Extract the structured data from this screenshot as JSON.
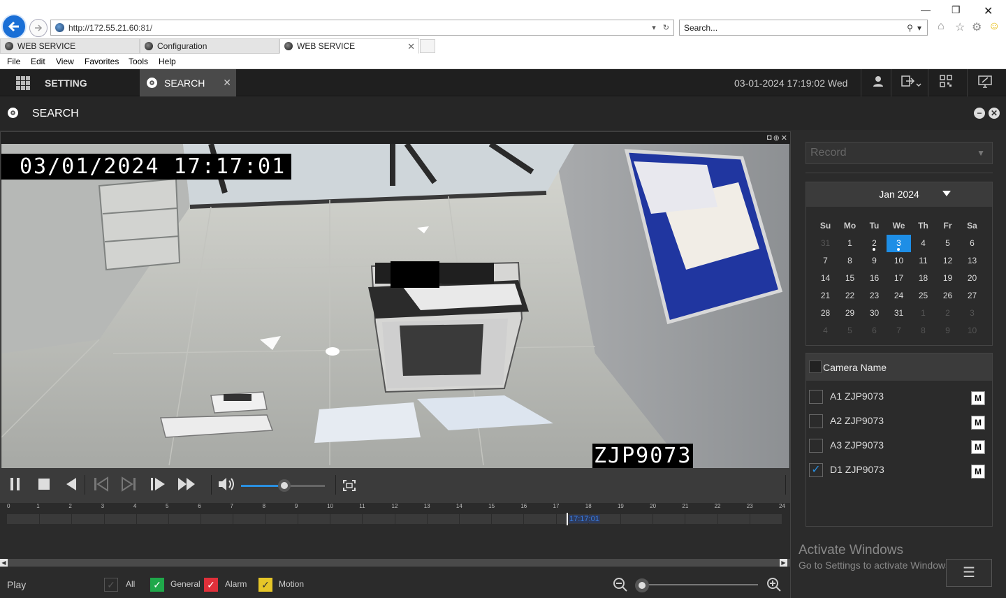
{
  "browser": {
    "url_host": "http://172.55.21.60",
    "url_port": ":81/",
    "search_placeholder": "Search...",
    "tabs": [
      {
        "label": "WEB SERVICE"
      },
      {
        "label": "Configuration"
      },
      {
        "label": "WEB SERVICE"
      }
    ],
    "menu": [
      "File",
      "Edit",
      "View",
      "Favorites",
      "Tools",
      "Help"
    ]
  },
  "header": {
    "setting_label": "SETTING",
    "search_tab_label": "SEARCH",
    "datetime": "03-01-2024 17:19:02 Wed"
  },
  "panel": {
    "title": "SEARCH"
  },
  "video": {
    "osd_time": "03/01/2024 17:17:01",
    "osd_camera": "ZJP9073",
    "volume_level": 0.52
  },
  "timeline": {
    "hours": [
      "0",
      "1",
      "2",
      "3",
      "4",
      "5",
      "6",
      "7",
      "8",
      "9",
      "10",
      "11",
      "12",
      "13",
      "14",
      "15",
      "16",
      "17",
      "18",
      "19",
      "20",
      "21",
      "22",
      "23",
      "24"
    ],
    "cursor_time": "17:17:01"
  },
  "legend": {
    "play_label": "Play",
    "items": [
      {
        "label": "All",
        "color": "#2b2b2b",
        "checked": true
      },
      {
        "label": "General",
        "color": "#1fa84a",
        "checked": true
      },
      {
        "label": "Alarm",
        "color": "#e0303a",
        "checked": true
      },
      {
        "label": "Motion",
        "color": "#e6c628",
        "checked": true
      }
    ]
  },
  "record_type": {
    "value": "Record"
  },
  "calendar": {
    "month_label": "Jan 2024",
    "weekdays": [
      "Su",
      "Mo",
      "Tu",
      "We",
      "Th",
      "Fr",
      "Sa"
    ],
    "weeks": [
      [
        "31",
        "1",
        "2",
        "3",
        "4",
        "5",
        "6"
      ],
      [
        "7",
        "8",
        "9",
        "10",
        "11",
        "12",
        "13"
      ],
      [
        "14",
        "15",
        "16",
        "17",
        "18",
        "19",
        "20"
      ],
      [
        "21",
        "22",
        "23",
        "24",
        "25",
        "26",
        "27"
      ],
      [
        "28",
        "29",
        "30",
        "31",
        "1",
        "2",
        "3"
      ],
      [
        "4",
        "5",
        "6",
        "7",
        "8",
        "9",
        "10"
      ]
    ],
    "selected_day": "3",
    "days_with_record": [
      "2",
      "3"
    ]
  },
  "cameras": {
    "header_label": "Camera Name",
    "items": [
      {
        "name": "A1 ZJP9073",
        "checked": false,
        "m_label": "M"
      },
      {
        "name": "A2 ZJP9073",
        "checked": false,
        "m_label": "M"
      },
      {
        "name": "A3 ZJP9073",
        "checked": false,
        "m_label": "M"
      },
      {
        "name": "D1 ZJP9073",
        "checked": true,
        "m_label": "M"
      }
    ]
  },
  "watermark": {
    "line1": "Activate Windows",
    "line2": "Go to Settings to activate Windows."
  }
}
